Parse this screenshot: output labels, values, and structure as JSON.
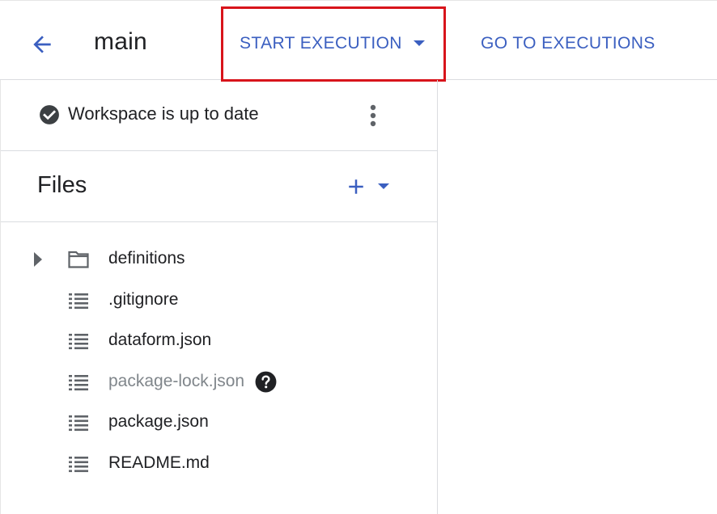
{
  "toolbar": {
    "title": "main",
    "start_execution_label": "START EXECUTION",
    "go_to_executions_label": "GO TO EXECUTIONS",
    "accent_color": "#3b5fc0",
    "highlight_color": "#d8141b"
  },
  "workspace": {
    "status_text": "Workspace is up to date",
    "status_icon": "check-circle-icon"
  },
  "files": {
    "title": "Files",
    "items": [
      {
        "name": "definitions",
        "icon": "folder-icon",
        "expandable": true,
        "muted": false
      },
      {
        "name": ".gitignore",
        "icon": "file-icon",
        "expandable": false,
        "muted": false
      },
      {
        "name": "dataform.json",
        "icon": "file-icon",
        "expandable": false,
        "muted": false
      },
      {
        "name": "package-lock.json",
        "icon": "file-icon",
        "expandable": false,
        "muted": true
      },
      {
        "name": "package.json",
        "icon": "file-icon",
        "expandable": false,
        "muted": false
      },
      {
        "name": "README.md",
        "icon": "file-icon",
        "expandable": false,
        "muted": false
      }
    ]
  }
}
